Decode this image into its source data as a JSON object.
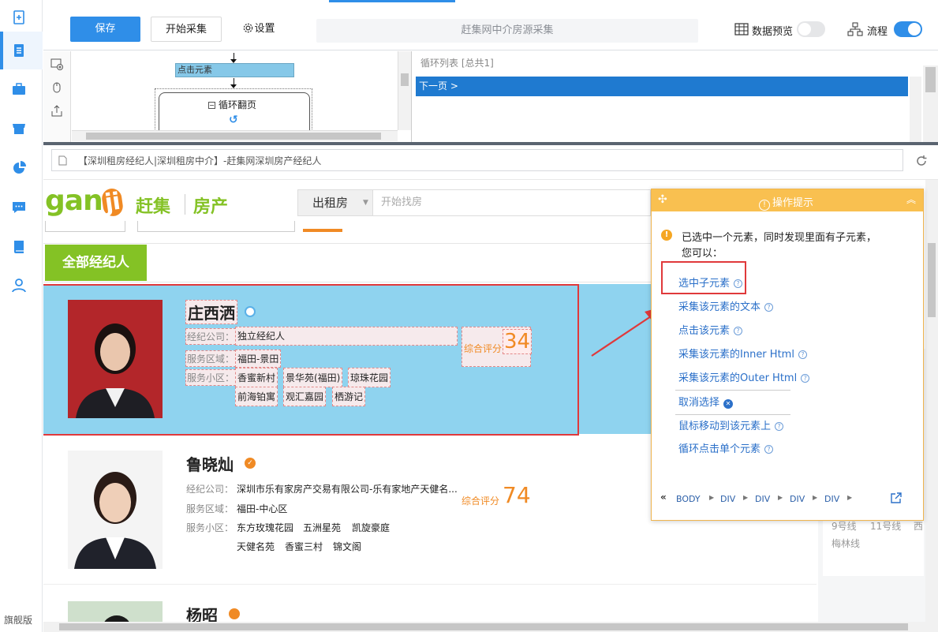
{
  "toolbar": {
    "save": "保存",
    "start": "开始采集",
    "settings": "设置",
    "task_title": "赶集网中介房源采集",
    "data_preview": "数据预览",
    "flow": "流程",
    "data_preview_on": false,
    "flow_on": true
  },
  "rail": {
    "edition": "旗舰版"
  },
  "workflow": {
    "node_click": "点击元素",
    "node_loop": "循环翻页"
  },
  "loop_list": {
    "header": "循环列表 [总共1]",
    "item": "下一页 >"
  },
  "url": "【深圳租房经纪人|深圳租房中介】-赶集网深圳房产经纪人",
  "site": {
    "logo_gan": "gan",
    "logo_ji": "ji",
    "logo_name": "赶集",
    "logo_category": "房产",
    "search_type": "出租房",
    "search_placeholder": "开始找房",
    "tab": "全部经纪人"
  },
  "agents": [
    {
      "name": "庄西洒",
      "company_label": "经纪公司：",
      "company": "独立经纪人",
      "area_label": "服务区域：",
      "area": "福田-景田",
      "community_label": "服务小区：",
      "communities": [
        "香蜜新村",
        "景华苑(福田)",
        "琼珠花园",
        "前海铂寓",
        "观汇嘉园",
        "栖游记"
      ],
      "score_label": "综合评分",
      "score": "34"
    },
    {
      "name": "鲁晓灿",
      "company_label": "经纪公司：",
      "company": "深圳市乐有家房产交易有限公司-乐有家地产天健名...",
      "area_label": "服务区域：",
      "area": "福田-中心区",
      "community_label": "服务小区：",
      "communities": [
        "东方玫瑰花园",
        "五洲星苑",
        "凯旋豪庭",
        "天健名苑",
        "香蜜三村",
        "锦文阁"
      ],
      "score_label": "综合评分",
      "score": "74"
    },
    {
      "name": "杨昭"
    }
  ],
  "side_panel": {
    "line1": "9号线",
    "line2": "11号线",
    "line3": "西",
    "line4": "梅林线"
  },
  "tip": {
    "title": "操作提示",
    "message_line1": "已选中一个元素，同时发现里面有子元素，",
    "message_line2": "您可以：",
    "options": [
      "选中子元素",
      "采集该元素的文本",
      "点击该元素",
      "采集该元素的Inner Html",
      "采集该元素的Outer Html",
      "取消选择",
      "鼠标移动到该元素上",
      "循环点击单个元素"
    ],
    "breadcrumb": [
      "BODY",
      "DIV",
      "DIV",
      "DIV",
      "DIV"
    ]
  },
  "colors": {
    "primary": "#2f8ee8",
    "selected_bg": "#8fd3ef",
    "highlight": "#e0393b",
    "tip_border": "#f9c050",
    "score": "#f08a24",
    "tab_green": "#84c225"
  }
}
